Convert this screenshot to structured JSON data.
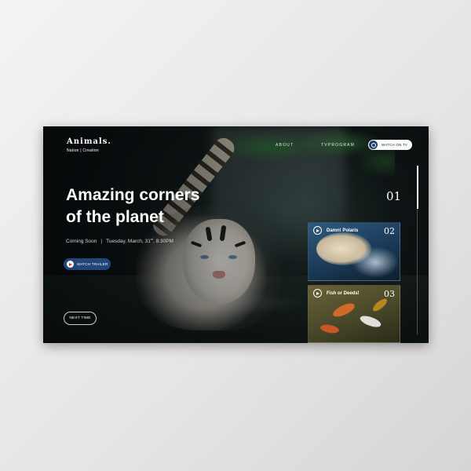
{
  "brand": {
    "title": "Animals.",
    "subtitle": "Nation | Creation"
  },
  "nav": {
    "about": "ABOUT",
    "tvprogram": "TVPROGRAM"
  },
  "watch_tv": {
    "label": "WATCH ON TV",
    "icon": "tv-circle-icon"
  },
  "hero": {
    "title_line1": "Amazing corners",
    "title_line2": "of the planet",
    "status": "Coming Soon",
    "date_prefix": "Tuesday, March, 31",
    "date_suffix": "st",
    "time": ", 8:30PM",
    "trailer_label": "WATCH TRAILER",
    "next_label": "NEXT TIME"
  },
  "pager": {
    "current": "01"
  },
  "cards": [
    {
      "title": "Damn! Polaris",
      "number": "02",
      "icon": "play-icon"
    },
    {
      "title": "Fish or Deeds!",
      "number": "03",
      "icon": "play-icon"
    }
  ],
  "colors": {
    "accent": "#22457a",
    "play_red": "#d0302a",
    "screen_bg": "#0c1011"
  }
}
